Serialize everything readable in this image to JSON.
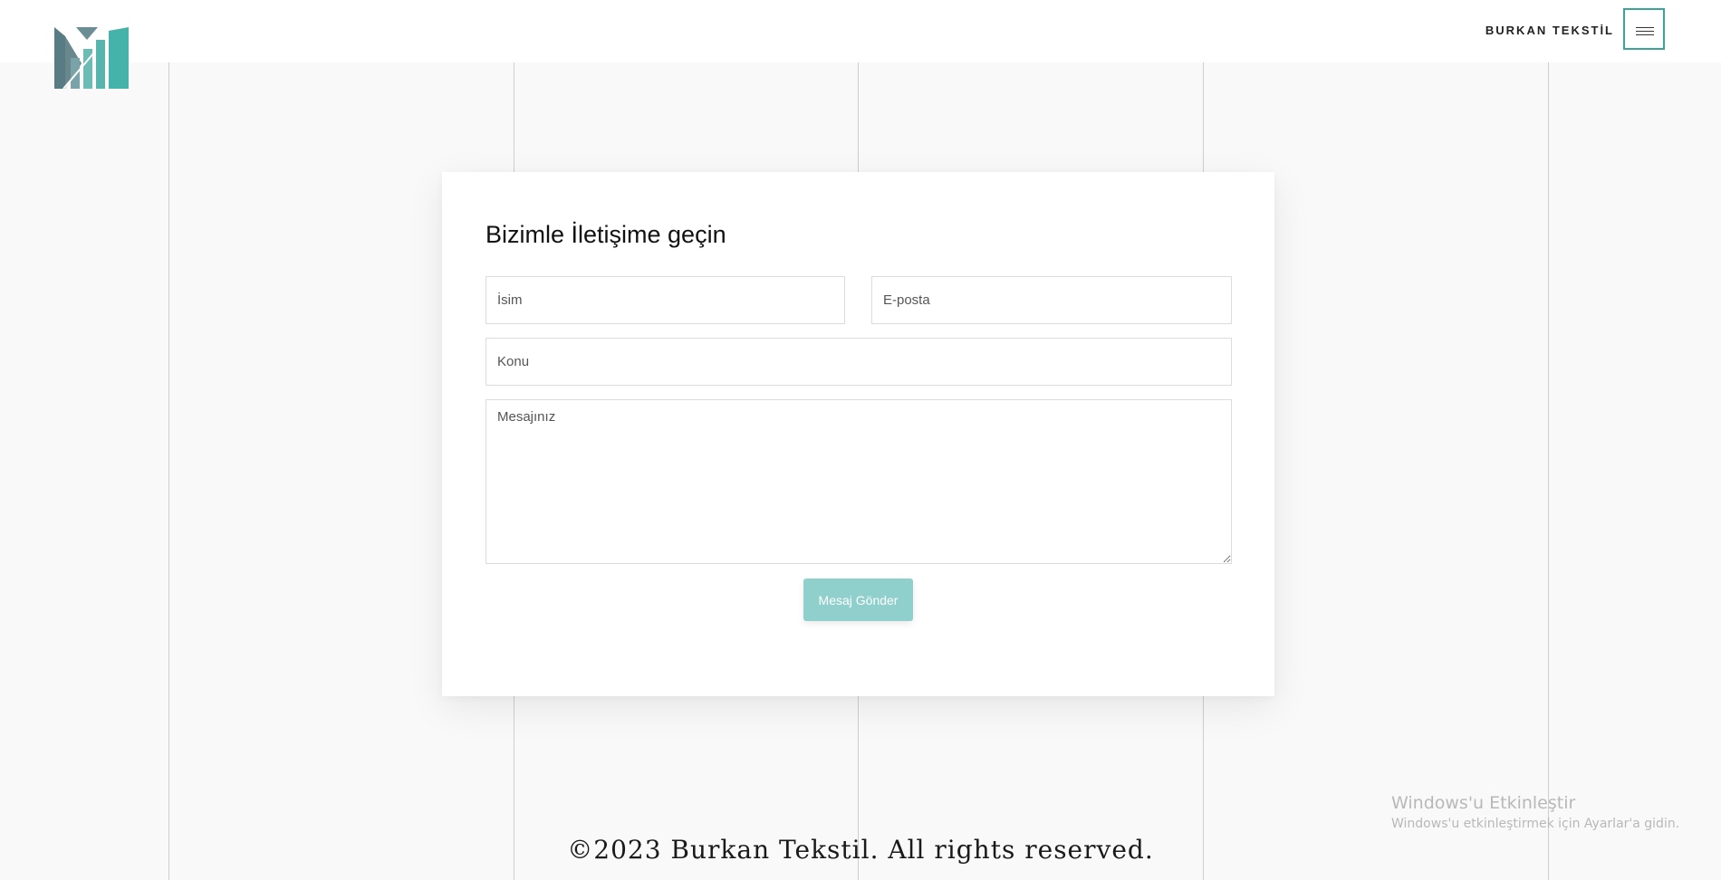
{
  "header": {
    "brand": "BURKAN TEKSTİL",
    "menu_icon": "hamburger-menu-icon",
    "logo_icon": "burkan-logo-icon"
  },
  "contact": {
    "title": "Bizimle İletişime geçin",
    "name_placeholder": "İsim",
    "email_placeholder": "E-posta",
    "subject_placeholder": "Konu",
    "message_placeholder": "Mesajınız",
    "send_label": "Mesaj Gönder"
  },
  "footer": {
    "copyright": "©2023 Burkan Tekstil. All rights reserved."
  },
  "watermark": {
    "title": "Windows'u Etkinleştir",
    "subtitle": "Windows'u etkinleştirmek için Ayarlar'a gidin."
  },
  "colors": {
    "accent": "#3aa39b",
    "button": "#8fcfcc",
    "background": "#f9f9f9",
    "logo_dark": "#5f7f86",
    "logo_light": "#46b3aa"
  }
}
